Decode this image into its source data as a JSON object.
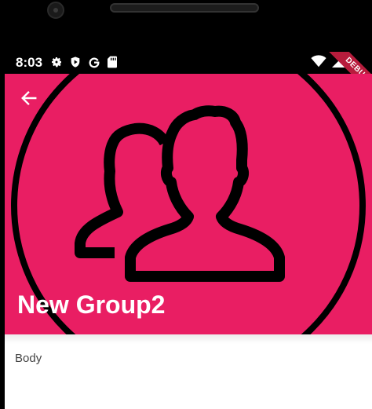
{
  "status_bar": {
    "time": "8:03",
    "left_icons": [
      "settings-icon",
      "shield-play-icon",
      "google-icon",
      "sd-card-icon"
    ],
    "right_icons": [
      "wifi-icon",
      "signal-icon"
    ]
  },
  "app_bar": {
    "title": "New Group2",
    "back_icon": "arrow-back-icon",
    "background_color": "#e91e63",
    "header_icon": "group-icon"
  },
  "body": {
    "text": "Body"
  },
  "debug_banner": {
    "label": "DEBUG",
    "color": "#b71c3c"
  }
}
